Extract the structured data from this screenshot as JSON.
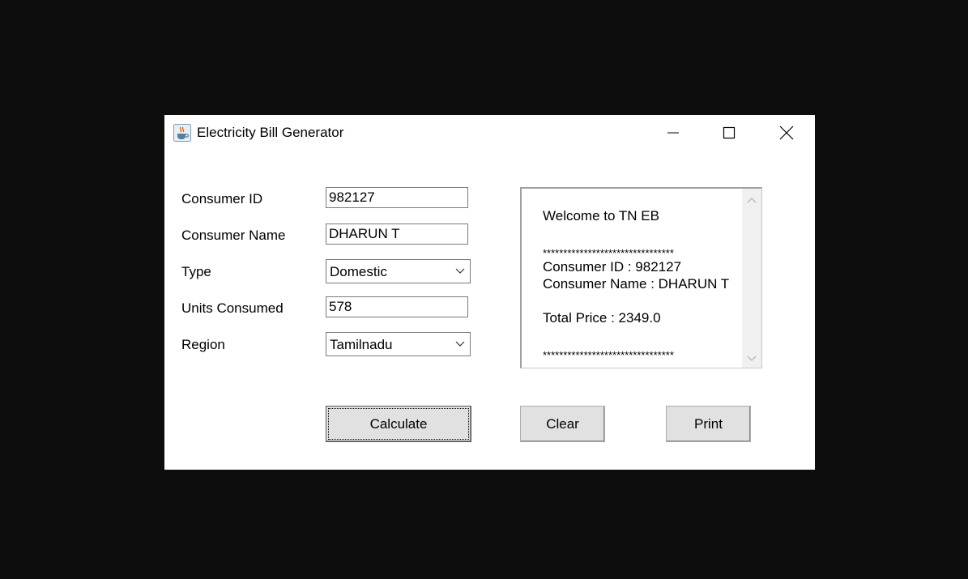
{
  "window": {
    "title": "Electricity Bill Generator",
    "icon": "java-cup-icon"
  },
  "form": {
    "consumer_id": {
      "label": "Consumer ID",
      "value": "982127"
    },
    "consumer_name": {
      "label": "Consumer Name",
      "value": "DHARUN T"
    },
    "type": {
      "label": "Type",
      "value": "Domestic"
    },
    "units": {
      "label": "Units Consumed",
      "value": "578"
    },
    "region": {
      "label": "Region",
      "value": "Tamilnadu"
    }
  },
  "output": {
    "lines": [
      "Welcome to TN EB",
      "",
      "********************************",
      "Consumer ID : 982127",
      "Consumer Name : DHARUN T",
      "",
      "Total Price : 2349.0",
      "",
      "********************************"
    ]
  },
  "buttons": {
    "calculate": "Calculate",
    "clear": "Clear",
    "print": "Print"
  }
}
